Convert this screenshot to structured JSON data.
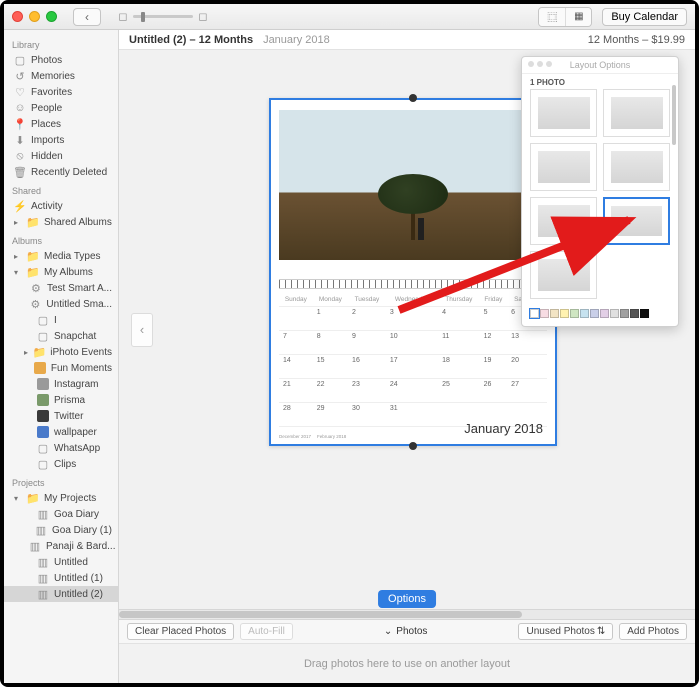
{
  "titlebar": {
    "buy_label": "Buy Calendar"
  },
  "infobar": {
    "title": "Untitled (2) – 12 Months",
    "subtitle": "January 2018",
    "price": "12 Months – $19.99"
  },
  "sidebar": {
    "library_head": "Library",
    "library": [
      {
        "label": "Photos",
        "icon": "photo-stack"
      },
      {
        "label": "Memories",
        "icon": "clock-rewind"
      },
      {
        "label": "Favorites",
        "icon": "heart"
      },
      {
        "label": "People",
        "icon": "person"
      },
      {
        "label": "Places",
        "icon": "pin"
      },
      {
        "label": "Imports",
        "icon": "download"
      },
      {
        "label": "Hidden",
        "icon": "eye-off"
      },
      {
        "label": "Recently Deleted",
        "icon": "trash"
      }
    ],
    "shared_head": "Shared",
    "shared": [
      {
        "label": "Activity",
        "icon": "lightning"
      },
      {
        "label": "Shared Albums",
        "icon": "folder",
        "disclosure": true
      }
    ],
    "albums_head": "Albums",
    "media_types": {
      "label": "Media Types",
      "disclosure": true
    },
    "my_albums": {
      "label": "My Albums",
      "disclosure": "open"
    },
    "albums": [
      {
        "label": "Test Smart A...",
        "icon": "gear"
      },
      {
        "label": "Untitled Sma...",
        "icon": "gear"
      },
      {
        "label": "I",
        "icon": "album"
      },
      {
        "label": "Snapchat",
        "icon": "album"
      },
      {
        "label": "iPhoto Events",
        "icon": "folder",
        "disclosure": true
      },
      {
        "label": "Fun Moments",
        "icon": "thumb-orange"
      },
      {
        "label": "Instagram",
        "icon": "thumb-gray"
      },
      {
        "label": "Prisma",
        "icon": "thumb-color"
      },
      {
        "label": "Twitter",
        "icon": "thumb-dark"
      },
      {
        "label": "wallpaper",
        "icon": "thumb-blue"
      },
      {
        "label": "WhatsApp",
        "icon": "album"
      },
      {
        "label": "Clips",
        "icon": "album"
      }
    ],
    "projects_head": "Projects",
    "my_projects": {
      "label": "My Projects",
      "disclosure": "open"
    },
    "projects": [
      {
        "label": "Goa Diary"
      },
      {
        "label": "Goa Diary (1)"
      },
      {
        "label": "Panaji & Bard..."
      },
      {
        "label": "Untitled"
      },
      {
        "label": "Untitled (1)"
      },
      {
        "label": "Untitled (2)",
        "selected": true
      }
    ]
  },
  "calendar": {
    "month_label": "January 2018",
    "weekdays": [
      "Sunday",
      "Monday",
      "Tuesday",
      "Wednesday",
      "Thursday",
      "Friday",
      "Saturday"
    ],
    "weeks": [
      [
        "",
        "1",
        "2",
        "3",
        "4",
        "5",
        "6"
      ],
      [
        "7",
        "8",
        "9",
        "10",
        "11",
        "12",
        "13"
      ],
      [
        "14",
        "15",
        "16",
        "17",
        "18",
        "19",
        "20"
      ],
      [
        "21",
        "22",
        "23",
        "24",
        "25",
        "26",
        "27"
      ],
      [
        "28",
        "29",
        "30",
        "31",
        "",
        "",
        ""
      ]
    ],
    "mini_prev": "December 2017",
    "mini_next": "February 2018"
  },
  "layout_panel": {
    "title": "Layout Options",
    "section": "1 PHOTO",
    "swatches": [
      "#ffffff",
      "#f7dce3",
      "#f2e4c4",
      "#fff2b0",
      "#cfe6c2",
      "#c6e2ef",
      "#c9cfe8",
      "#e2cfe6",
      "#e0e0e0",
      "#a0a0a0",
      "#555555",
      "#101010"
    ]
  },
  "options_button": "Options",
  "toolbar": {
    "clear": "Clear Placed Photos",
    "autofill": "Auto-Fill",
    "center": "Photos",
    "filter": "Unused Photos",
    "add": "Add Photos"
  },
  "footer": "Drag photos here to use on another layout"
}
